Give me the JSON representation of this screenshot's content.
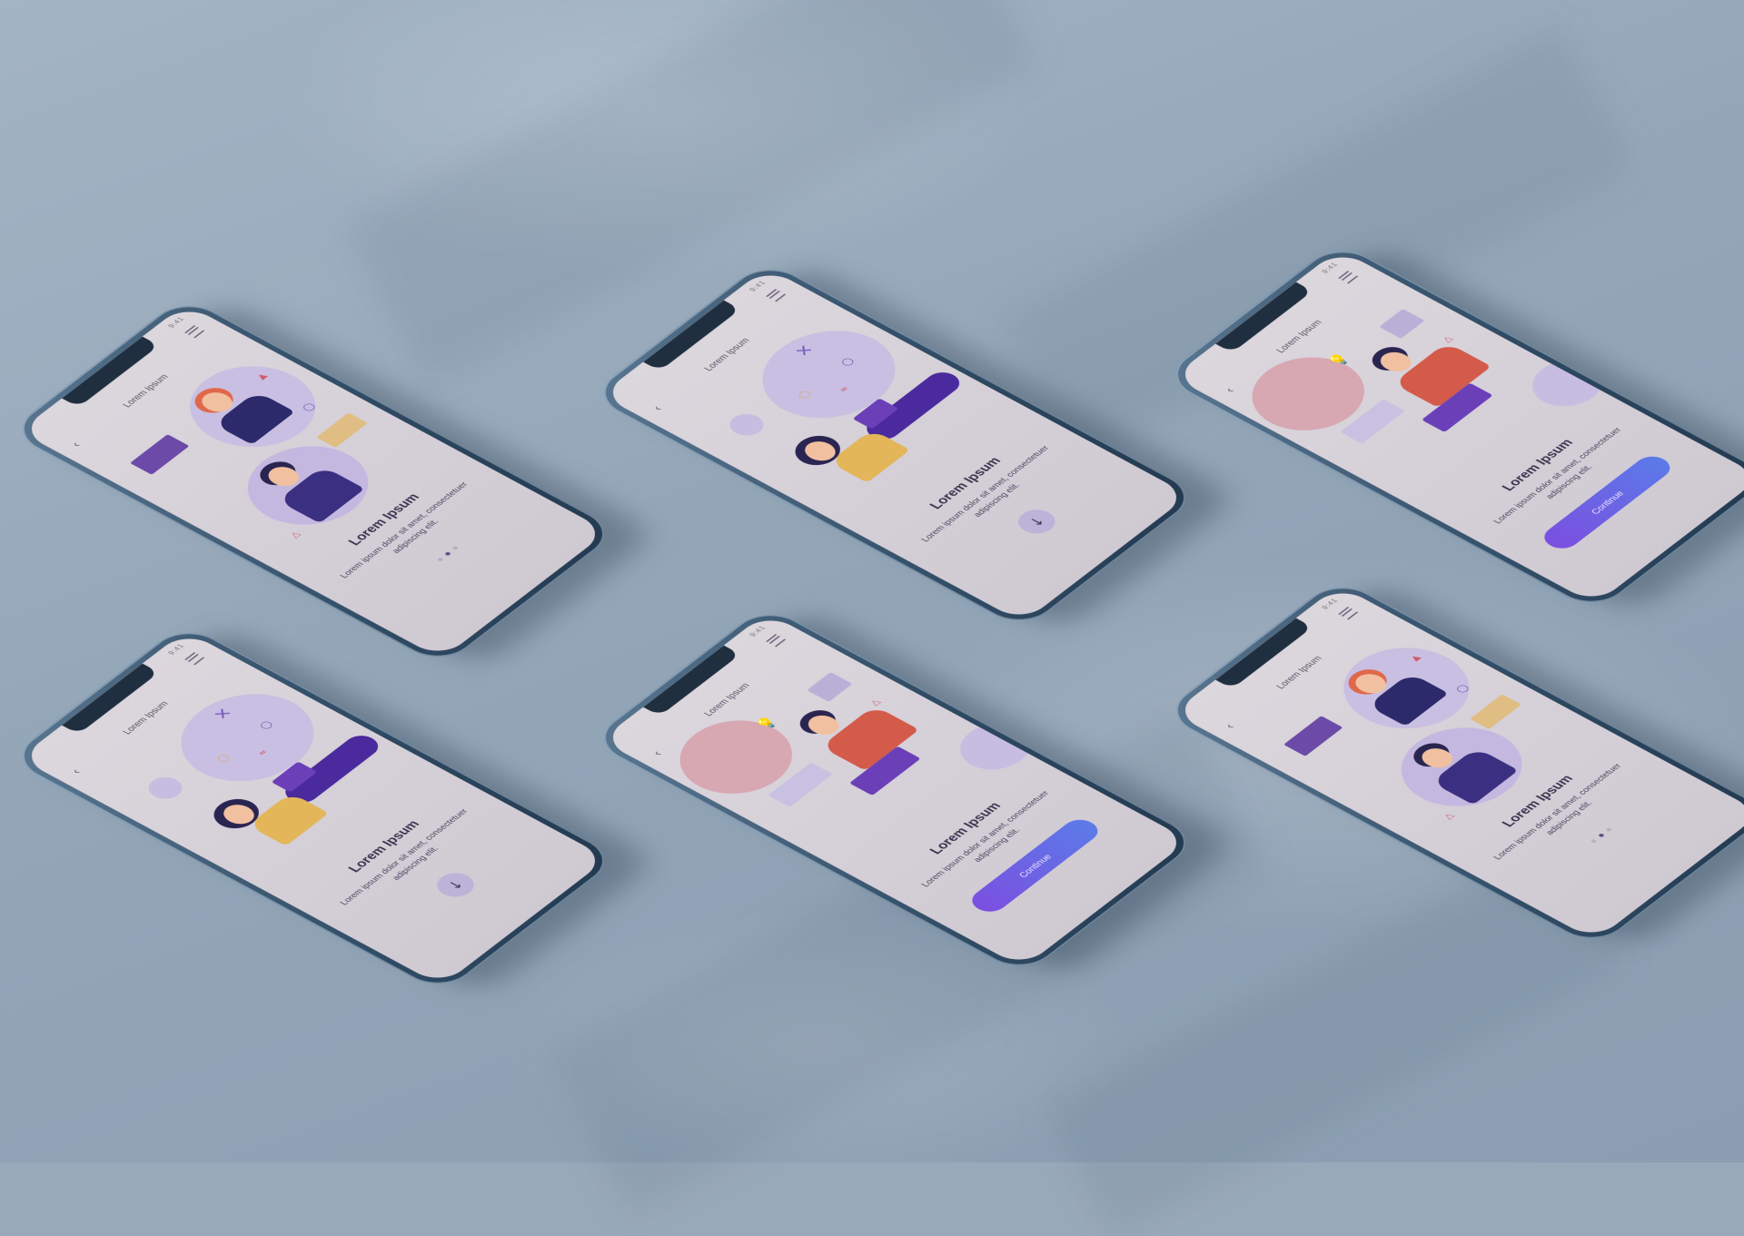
{
  "screens": [
    {
      "title": "Lorem Ipsum",
      "heading": "Lorem Ipsum",
      "body": "Lorem ipsum dolor sit amet, consectetuer adipiscing elit.",
      "control": "dots",
      "active_dot": 1,
      "illustration": "two-people-chat"
    },
    {
      "title": "Lorem Ipsum",
      "heading": "Lorem Ipsum",
      "body": "Lorem ipsum dolor sit amet, consectetuer adipiscing elit.",
      "control": "arrow",
      "arrow_glyph": "↓",
      "illustration": "woman-laptop"
    },
    {
      "title": "Lorem Ipsum",
      "heading": "Lorem Ipsum",
      "body": "Lorem ipsum dolor sit amet, consectetuer adipiscing elit.",
      "control": "continue",
      "continue_label": "Continue",
      "illustration": "man-idea-laptop"
    },
    {
      "title": "Lorem Ipsum",
      "heading": "Lorem Ipsum",
      "body": "Lorem ipsum dolor sit amet, consectetuer adipiscing elit.",
      "control": "arrow",
      "arrow_glyph": "↓",
      "illustration": "woman-laptop"
    },
    {
      "title": "Lorem Ipsum",
      "heading": "Lorem Ipsum",
      "body": "Lorem ipsum dolor sit amet, consectetuer adipiscing elit.",
      "control": "continue",
      "continue_label": "Continue",
      "illustration": "man-idea-laptop"
    },
    {
      "title": "Lorem Ipsum",
      "heading": "Lorem Ipsum",
      "body": "Lorem ipsum dolor sit amet, consectetuer adipiscing elit.",
      "control": "dots",
      "active_dot": 1,
      "illustration": "two-people-chat"
    }
  ],
  "status_bar": "9:41",
  "icons": {
    "menu": "hamburger-icon",
    "back": "chevron-left-icon",
    "next": "arrow-down-icon"
  },
  "colors": {
    "accent_purple": "#5b3fb0",
    "button_gradient_start": "#7b4fe0",
    "button_gradient_end": "#5b7be8",
    "blob_lavender": "#c7bde0",
    "blob_pink": "#d7a7b2",
    "blob_peach": "#e8c79a",
    "phone_frame": "#2f4a63"
  }
}
